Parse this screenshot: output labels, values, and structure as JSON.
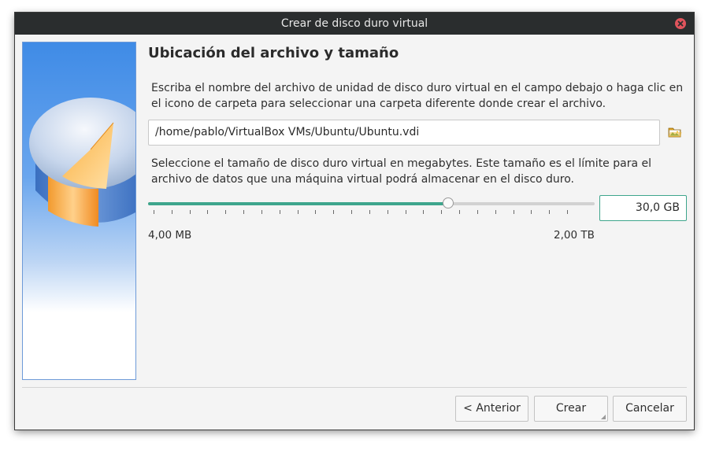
{
  "window": {
    "title": "Crear de disco duro virtual"
  },
  "page": {
    "heading": "Ubicación del archivo y tamaño",
    "location_description": "Escriba el nombre del archivo de unidad de disco duro virtual en el campo debajo o haga clic en el icono de carpeta para seleccionar una carpeta diferente donde crear el archivo.",
    "file_path": "/home/pablo/VirtualBox VMs/Ubuntu/Ubuntu.vdi",
    "size_description": "Seleccione el tamaño de disco duro virtual en megabytes. Este tamaño es el límite para el archivo de datos que una máquina virtual podrá almacenar en el disco duro.",
    "size_value": "30,0 GB",
    "slider_fraction": 0.672,
    "slider_ticks": 24,
    "scale_min": "4,00 MB",
    "scale_max": "2,00 TB"
  },
  "buttons": {
    "back": "< Anterior",
    "create": "Crear",
    "cancel": "Cancelar"
  },
  "colors": {
    "accent": "#3ea58c",
    "titlebar": "#2a2d2e",
    "close": "#e0545c"
  },
  "icons": {
    "close": "close-icon",
    "folder": "folder-open-icon",
    "wizard_image": "hard-disk-illustration"
  }
}
